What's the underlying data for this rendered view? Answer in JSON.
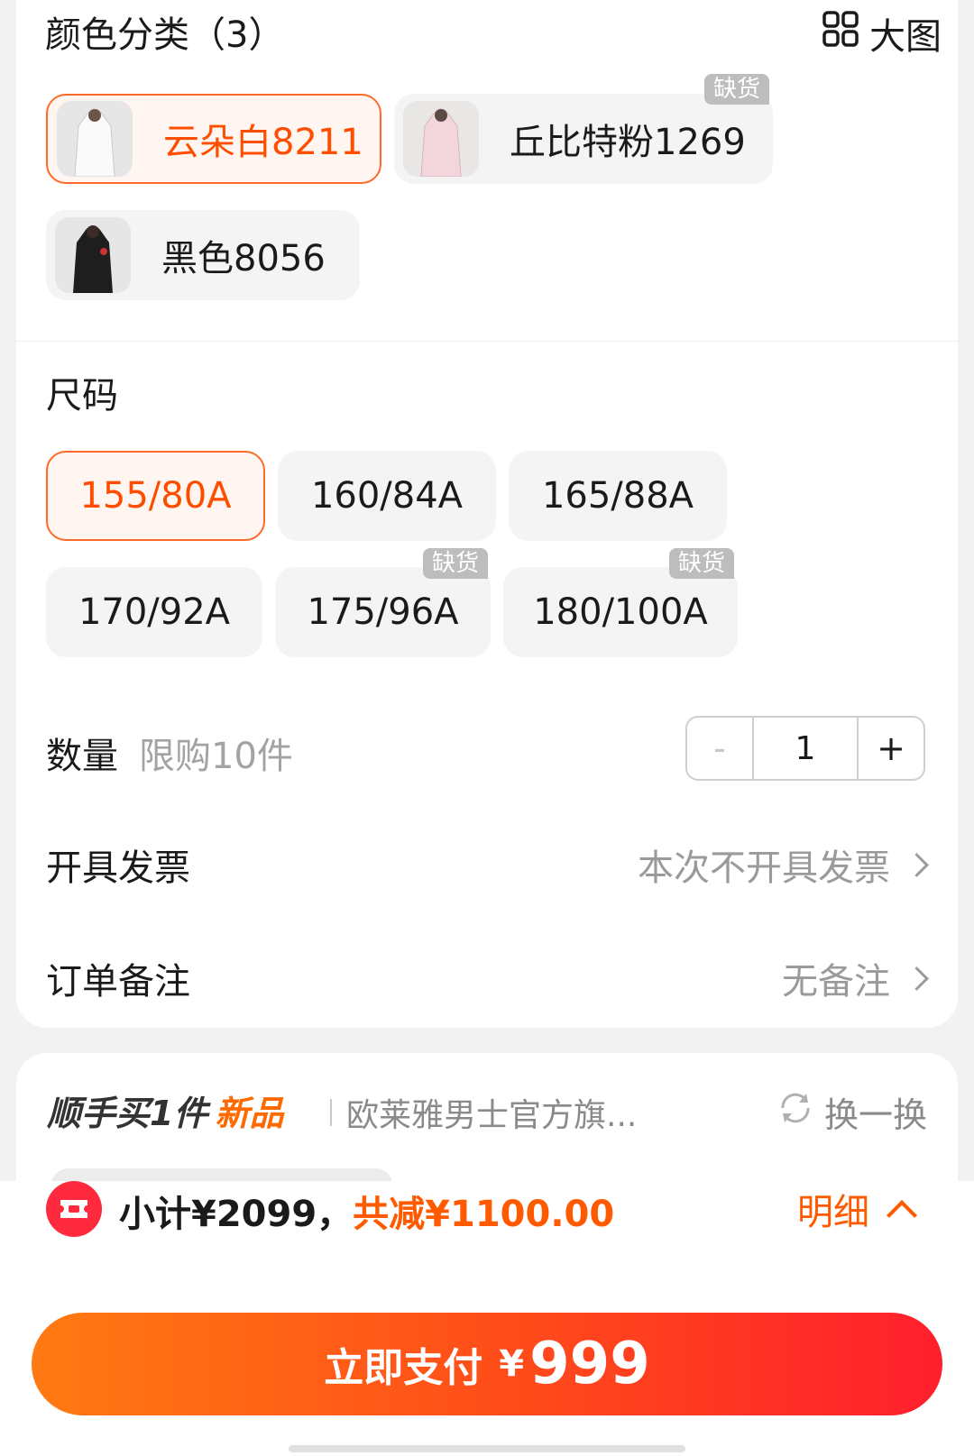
{
  "color_section": {
    "title": "颜色分类（3）",
    "big_image_label": "大图",
    "options": [
      {
        "label": "云朵白8211",
        "selected": true,
        "out_of_stock": false
      },
      {
        "label": "丘比特粉1269",
        "selected": false,
        "out_of_stock": true
      },
      {
        "label": "黑色8056",
        "selected": false,
        "out_of_stock": false
      }
    ],
    "out_of_stock_tag": "缺货"
  },
  "size_section": {
    "title": "尺码",
    "options": [
      {
        "label": "155/80A",
        "selected": true,
        "out_of_stock": false
      },
      {
        "label": "160/84A",
        "selected": false,
        "out_of_stock": false
      },
      {
        "label": "165/88A",
        "selected": false,
        "out_of_stock": false
      },
      {
        "label": "170/92A",
        "selected": false,
        "out_of_stock": false
      },
      {
        "label": "175/96A",
        "selected": false,
        "out_of_stock": true
      },
      {
        "label": "180/100A",
        "selected": false,
        "out_of_stock": true
      }
    ]
  },
  "quantity": {
    "label": "数量",
    "limit": "限购10件",
    "minus": "-",
    "value": "1",
    "plus": "+"
  },
  "invoice": {
    "label": "开具发票",
    "value": "本次不开具发票"
  },
  "remark": {
    "label": "订单备注",
    "value": "无备注"
  },
  "recommend": {
    "title": "顺手买1件",
    "badge": "新品",
    "shop": "欧莱雅男士官方旗...",
    "refresh": "换一换"
  },
  "summary": {
    "subtotal": "小计¥2099，",
    "discount": "共减¥1100.00",
    "detail": "明细"
  },
  "pay": {
    "label": "立即支付",
    "currency": "¥",
    "amount": "999"
  },
  "colors": {
    "accent": "#ff4d00",
    "accent_light": "#fff6f1",
    "chip_bg": "#f4f4f4",
    "muted": "#9a9a9a"
  }
}
